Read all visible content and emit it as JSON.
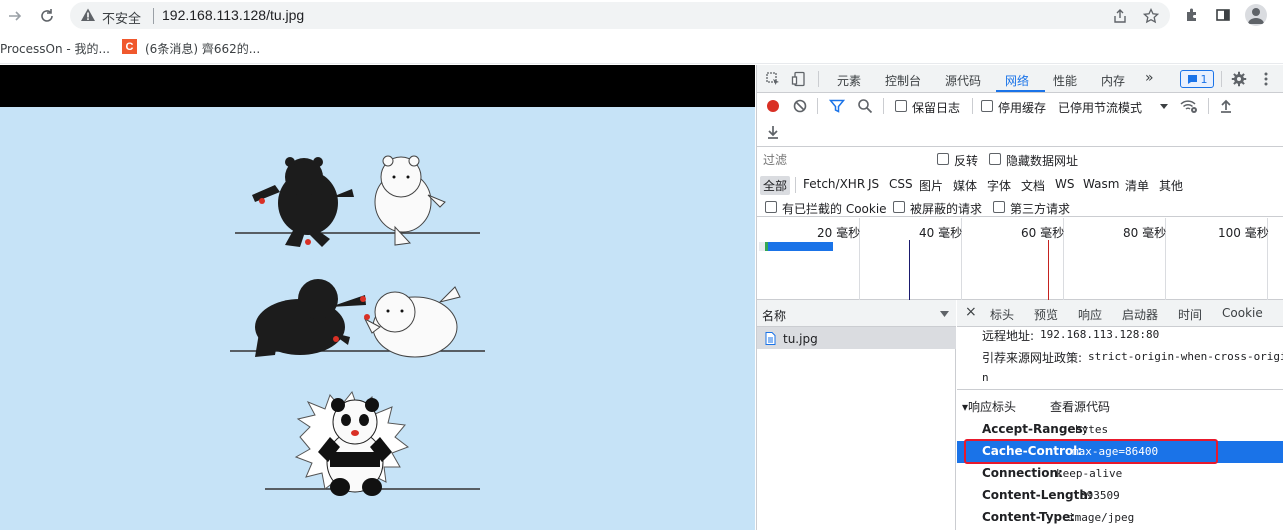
{
  "browser": {
    "security_label": "不安全",
    "url": "192.168.113.128/tu.jpg"
  },
  "bookmarks": [
    {
      "label": "ProcessOn - 我的..."
    },
    {
      "label": "(6条消息) 齊662的..."
    }
  ],
  "devtools": {
    "tabs": [
      "元素",
      "控制台",
      "源代码",
      "网络",
      "性能",
      "内存"
    ],
    "active_tab": "网络",
    "issues_count": "1",
    "toolbar": {
      "preserve_log": "保留日志",
      "disable_cache": "停用缓存",
      "throttling": "已停用节流模式"
    },
    "filter": {
      "placeholder": "过滤",
      "invert": "反转",
      "hide_data_urls": "隐藏数据网址",
      "types": [
        "全部",
        "Fetch/XHR",
        "JS",
        "CSS",
        "图片",
        "媒体",
        "字体",
        "文档",
        "WS",
        "Wasm",
        "清单",
        "其他"
      ],
      "blocked_cookies": "有已拦截的 Cookie",
      "blocked_requests": "被屏蔽的请求",
      "third_party": "第三方请求"
    },
    "timeline": {
      "ticks": [
        "20 毫秒",
        "40 毫秒",
        "60 毫秒",
        "80 毫秒",
        "100 毫秒"
      ]
    },
    "requests": {
      "column_name": "名称",
      "rows": [
        {
          "name": "tu.jpg"
        }
      ]
    },
    "detail": {
      "tabs": [
        "标头",
        "预览",
        "响应",
        "启动器",
        "时间",
        "Cookie"
      ],
      "general": [
        {
          "key": "远程地址:",
          "value": "192.168.113.128:80"
        },
        {
          "key": "引荐来源网址政策:",
          "value": "strict-origin-when-cross-origin"
        }
      ],
      "general_wrap": "n",
      "response_headers_title": "▾响应标头",
      "view_source": "查看源代码",
      "response_headers": [
        {
          "key": "Accept-Ranges:",
          "value": "bytes"
        },
        {
          "key": "Cache-Control:",
          "value": "max-age=86400"
        },
        {
          "key": "Connection:",
          "value": "keep-alive"
        },
        {
          "key": "Content-Length:",
          "value": "393509"
        },
        {
          "key": "Content-Type:",
          "value": "image/jpeg"
        }
      ]
    }
  },
  "colors": {
    "accent": "#1a73e8",
    "highlight_box": "#e8192c",
    "image_bg": "#c6e3f7",
    "record": "#d93025"
  }
}
